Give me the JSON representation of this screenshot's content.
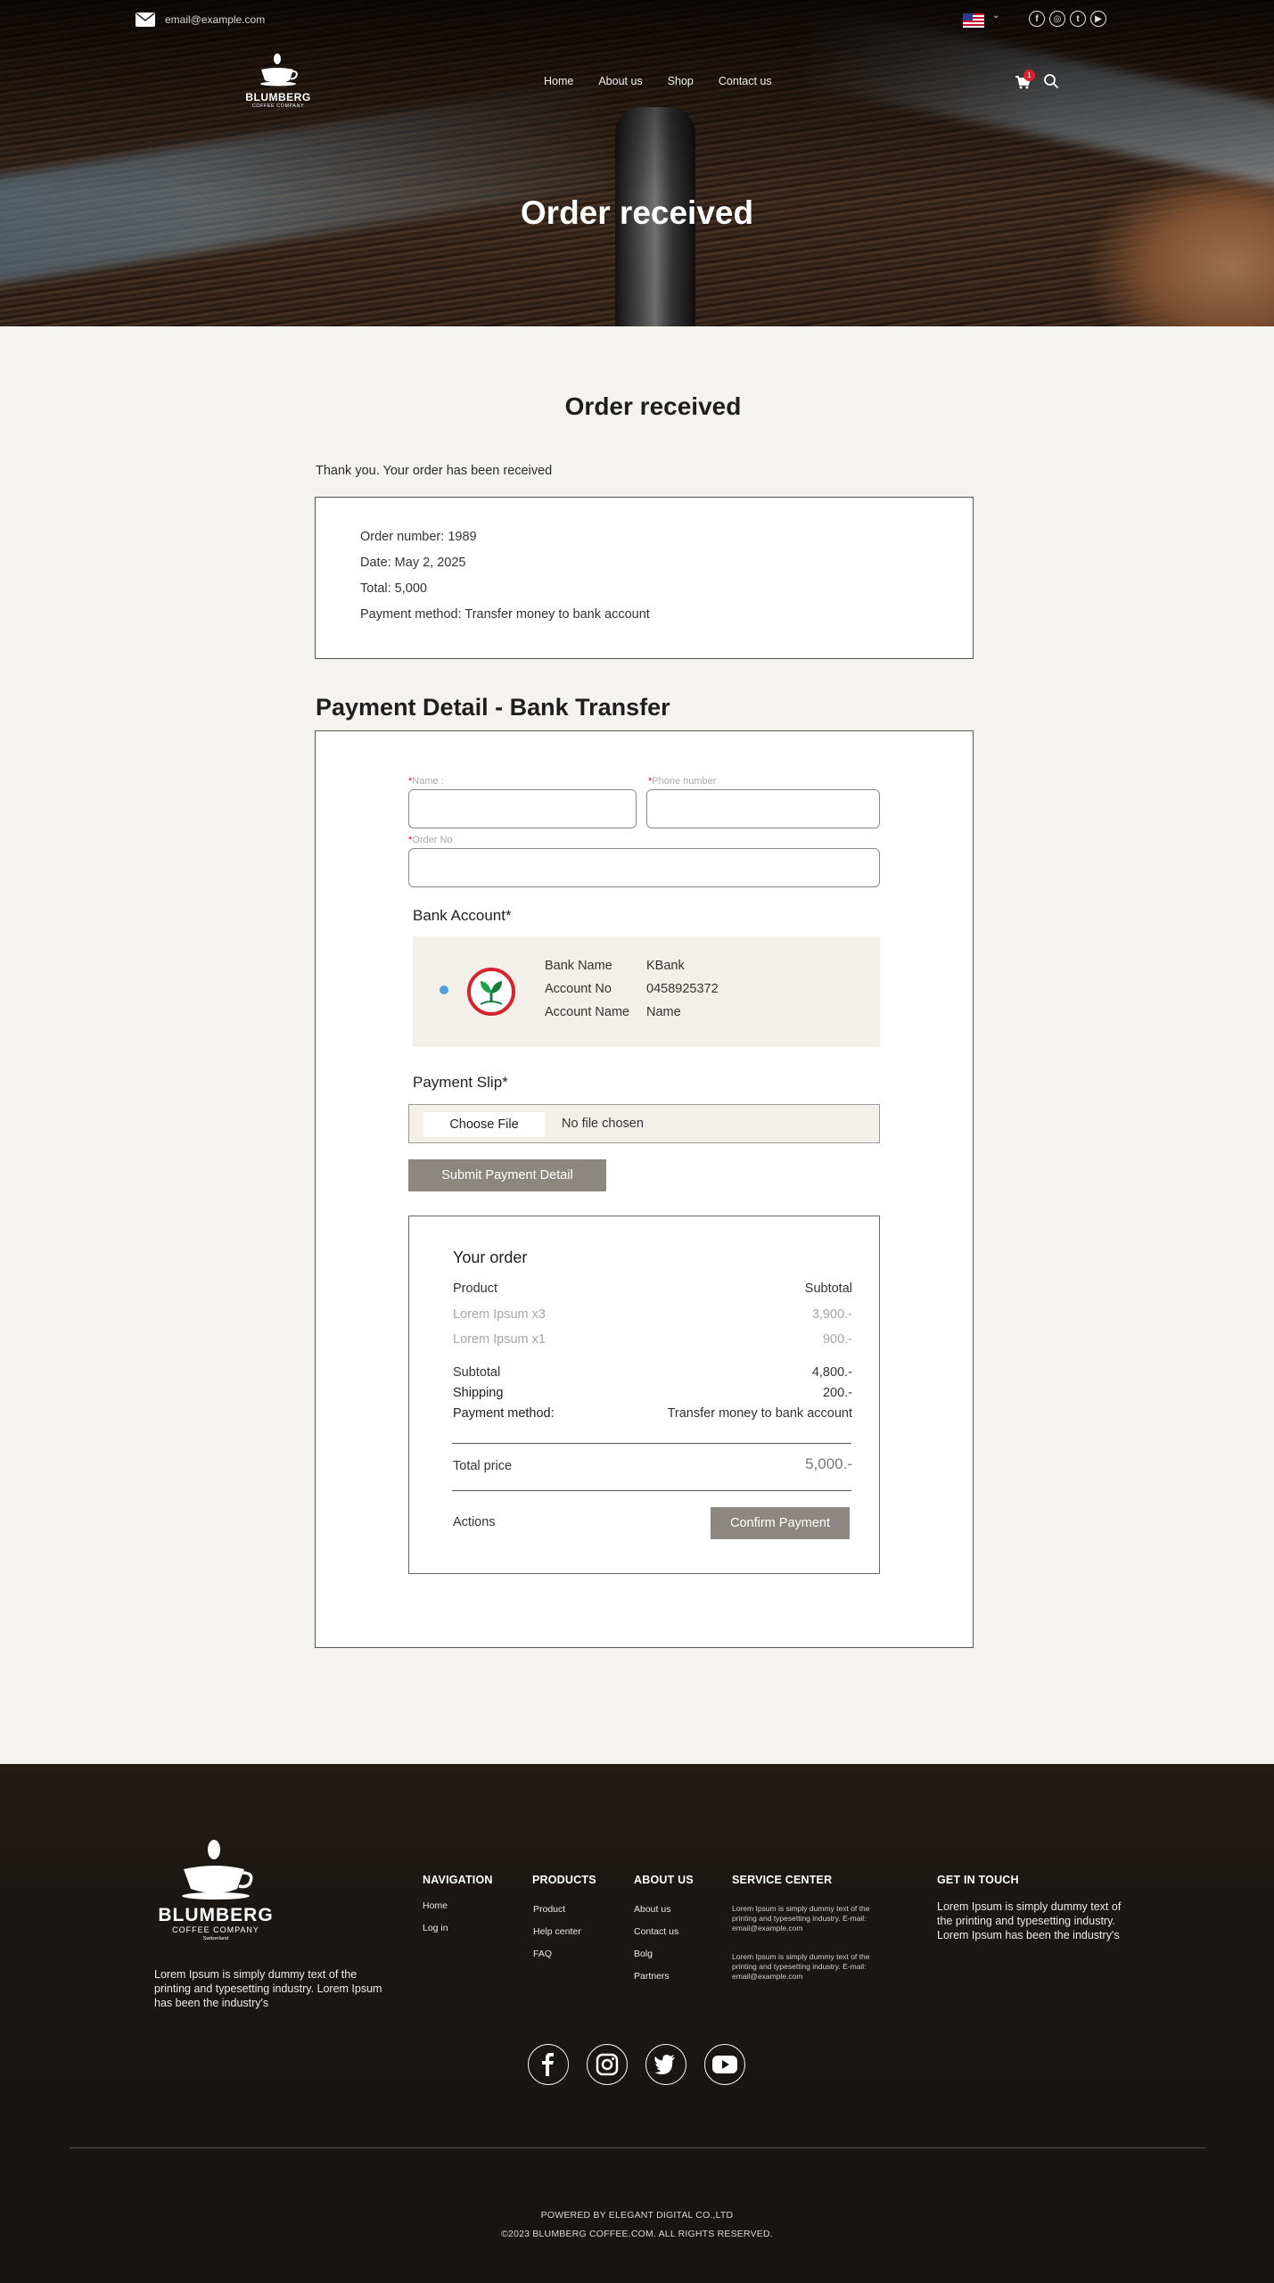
{
  "topbar": {
    "email": "email@example.com",
    "language_flag": "us-flag-icon"
  },
  "brand": {
    "name": "BLUMBERG",
    "subtitle": "COFFEE COMPANY",
    "origin": "Switzerland"
  },
  "nav": {
    "items": [
      "Home",
      "About us",
      "Shop",
      "Contact us"
    ],
    "cart_count": "1"
  },
  "hero": {
    "title": "Order received"
  },
  "main": {
    "title": "Order received",
    "thank_you": "Thank you. Your order has been received",
    "order": {
      "number": "Order number: 1989",
      "date": "Date: May 2, 2025",
      "total": "Total: 5,000",
      "method": "Payment method: Transfer money to bank account"
    }
  },
  "payment": {
    "title": "Payment Detail - Bank Transfer",
    "fields": {
      "name_label": "Name :",
      "phone_label": "Phone number",
      "order_label": "Order No",
      "name_value": "",
      "phone_value": "",
      "order_value": ""
    },
    "bank_section_title": "Bank Account*",
    "bank": {
      "name_label": "Bank Name",
      "name_value": "KBank",
      "acc_no_label": "Account No",
      "acc_no_value": "0458925372",
      "acc_name_label": "Account Name",
      "acc_name_value": "Name"
    },
    "slip_title": "Payment Slip*",
    "choose_file": "Choose File",
    "file_status": "No file chosen",
    "submit": "Submit Payment Detail"
  },
  "your_order": {
    "title": "Your order",
    "header_product": "Product",
    "header_subtotal": "Subtotal",
    "items": [
      {
        "name": "Lorem Ipsum x3",
        "price": "3,900.-"
      },
      {
        "name": "Lorem Ipsum x1",
        "price": "900.-"
      }
    ],
    "subtotal_label": "Subtotal",
    "subtotal_value": "4,800.-",
    "shipping_label": "Shipping",
    "shipping_value": "200.-",
    "method_label": "Payment method:",
    "method_value": "Transfer money to bank account",
    "total_label": "Total price",
    "total_value": "5,000.-",
    "actions_label": "Actions",
    "confirm": "Confirm Payment"
  },
  "footer": {
    "description": "Lorem Ipsum is simply dummy text of the printing and typesetting industry. Lorem Ipsum has been the industry's",
    "navigation": {
      "title": "NAVIGATION",
      "links": [
        "Home",
        "Log in"
      ]
    },
    "products": {
      "title": "PRODUCTS",
      "links": [
        "Product",
        "Help center",
        "FAQ"
      ]
    },
    "about": {
      "title": "ABOUT US",
      "links": [
        "About us",
        "Contact us",
        "Bolg",
        "Partners"
      ]
    },
    "service": {
      "title": "SERVICE CENTER",
      "blocks": [
        "Lorem Ipsum is simply dummy text of the printing and typesetting industry. E-mail: email@example.com",
        "Lorem Ipsum is simply dummy text of the printing and typesetting industry. E-mail: email@example.com"
      ]
    },
    "get_in_touch": {
      "title": "GET IN TOUCH",
      "text": "Lorem Ipsum is simply dummy text of the printing and typesetting industry. Lorem Ipsum has been the industry's"
    },
    "social": [
      "facebook-icon",
      "instagram-icon",
      "twitter-icon",
      "youtube-icon"
    ],
    "powered_by": "POWERED BY ELEGANT DIGITAL CO.,LTD",
    "copyright": "©2023 BLUMBERG COFFEE.COM. ALL RIGHTS RESERVED."
  }
}
